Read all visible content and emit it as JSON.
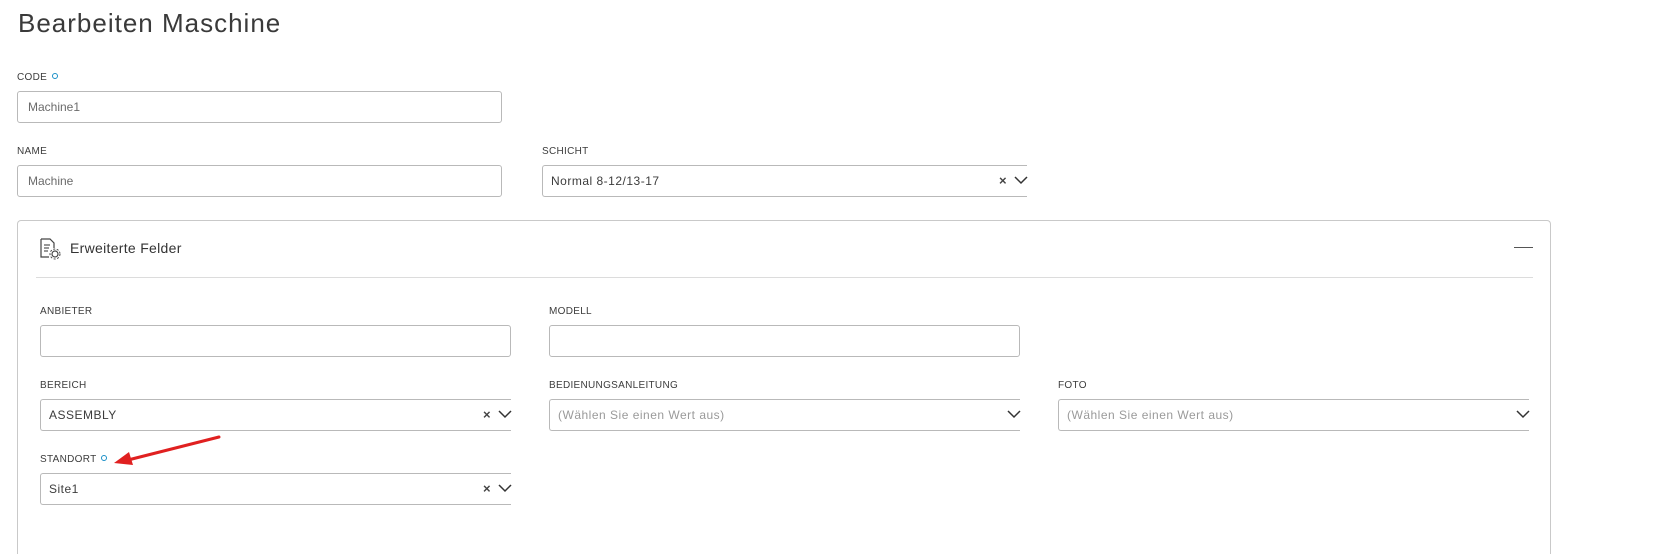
{
  "page": {
    "title": "Bearbeiten Maschine"
  },
  "code": {
    "label": "CODE",
    "value": "Machine1"
  },
  "name": {
    "label": "NAME",
    "value": "Machine"
  },
  "schicht": {
    "label": "SCHICHT",
    "value": "Normal 8-12/13-17",
    "clear": "×"
  },
  "extended": {
    "title": "Erweiterte Felder",
    "anbieter": {
      "label": "ANBIETER",
      "value": ""
    },
    "modell": {
      "label": "MODELL",
      "value": ""
    },
    "bereich": {
      "label": "BEREICH",
      "value": "ASSEMBLY",
      "clear": "×"
    },
    "bedienungsanleitung": {
      "label": "BEDIENUNGSANLEITUNG",
      "placeholder": "(Wählen Sie einen Wert aus)"
    },
    "foto": {
      "label": "FOTO",
      "placeholder": "(Wählen Sie einen Wert aus)"
    },
    "standort": {
      "label": "STANDORT",
      "value": "Site1",
      "clear": "×"
    }
  },
  "colors": {
    "accent": "#1a8fc7",
    "annotation_arrow": "#e02020",
    "border": "#b9b9b9"
  },
  "icons": {
    "panel": "document-settings-icon",
    "collapse": "minus-icon",
    "dropdown": "chevron-down-icon",
    "clear": "clear-x-icon",
    "required": "required-dot-icon"
  }
}
